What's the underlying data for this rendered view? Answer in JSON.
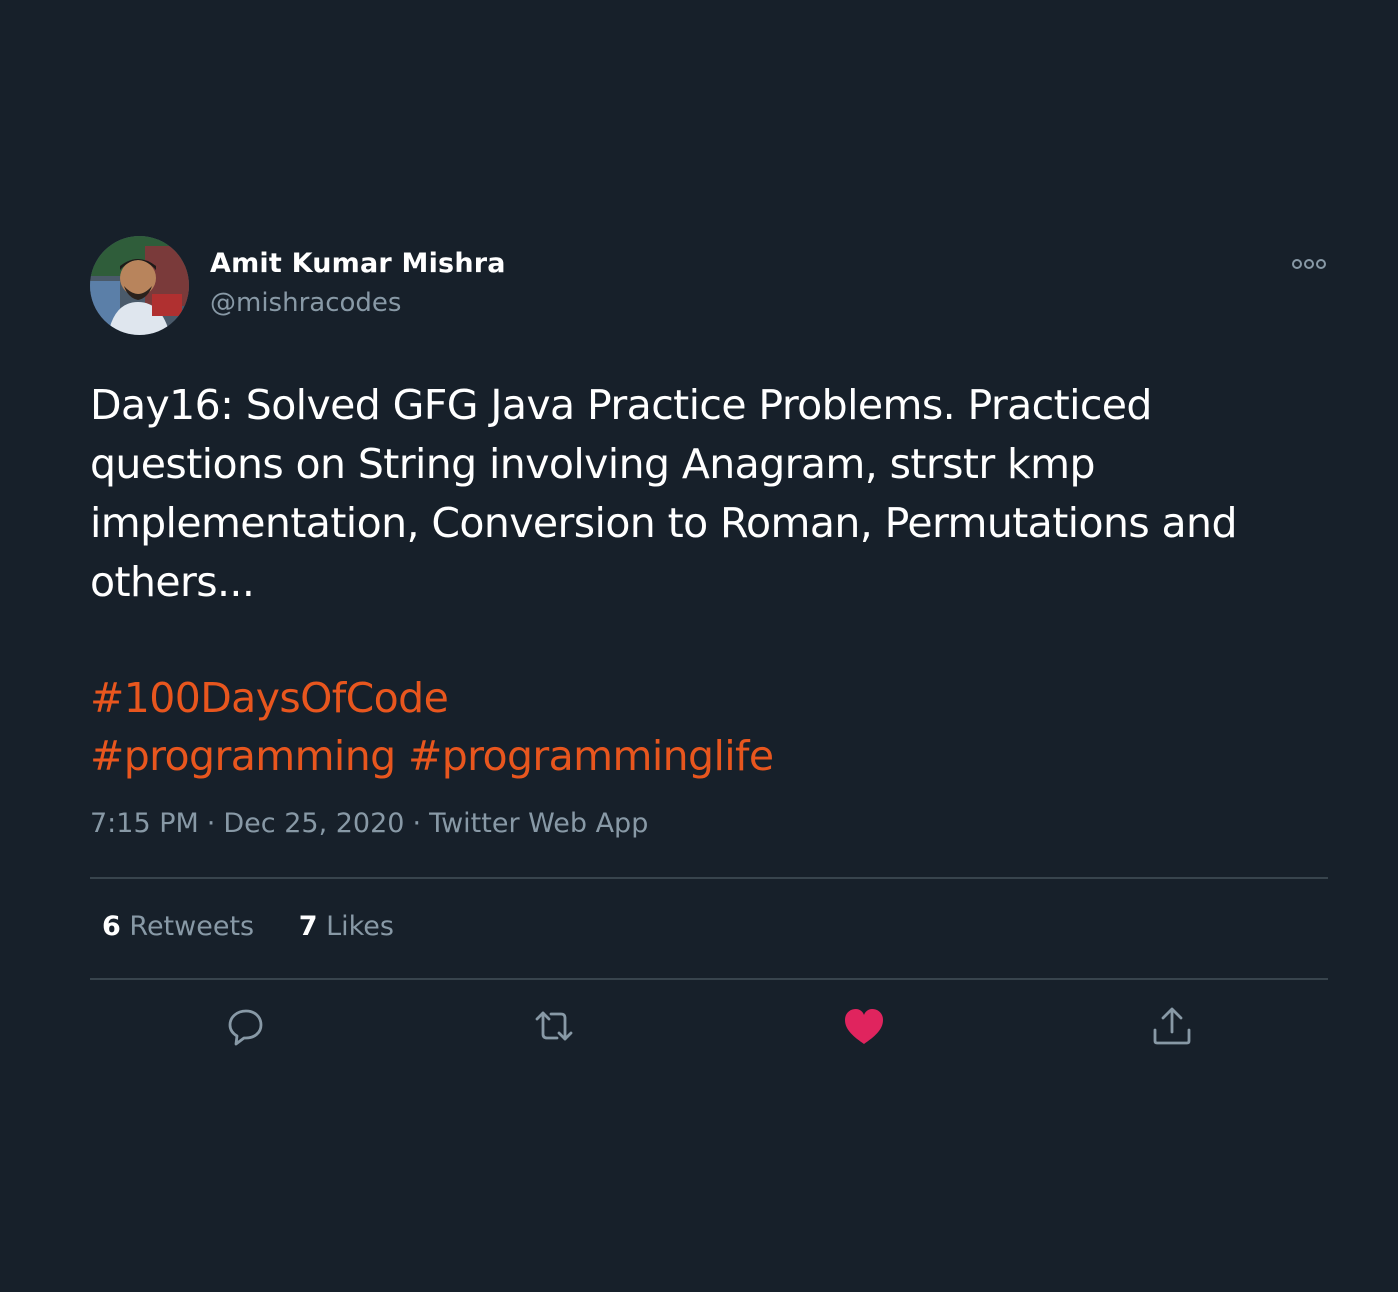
{
  "tweet": {
    "author": {
      "name": "Amit Kumar Mishra",
      "handle": "@mishracodes"
    },
    "text_lines": [
      "Day16: Solved GFG Java Practice Problems. Practiced",
      "questions on String involving Anagram, strstr kmp",
      "implementation, Conversion to Roman, Permutations and",
      "others..."
    ],
    "hashtags": [
      "#100DaysOfCode",
      "#programming",
      "#programminglife"
    ],
    "time": "7:15 PM",
    "date": "Dec 25, 2020",
    "source": "Twitter Web App",
    "separator": "·",
    "stats": {
      "retweets_count": "6",
      "retweets_label": "Retweets",
      "likes_count": "7",
      "likes_label": "Likes"
    },
    "actions": {
      "reply_icon": "comment-bubble-icon",
      "retweet_icon": "retweet-arrows-icon",
      "like_icon": "heart-filled-icon",
      "share_icon": "share-upload-icon",
      "liked": true
    }
  },
  "colors": {
    "background": "#17202a",
    "text_primary": "#ffffff",
    "text_secondary": "#8899a6",
    "hashtag": "#e8561e",
    "like_active": "#e0245e",
    "divider": "#38444d"
  }
}
